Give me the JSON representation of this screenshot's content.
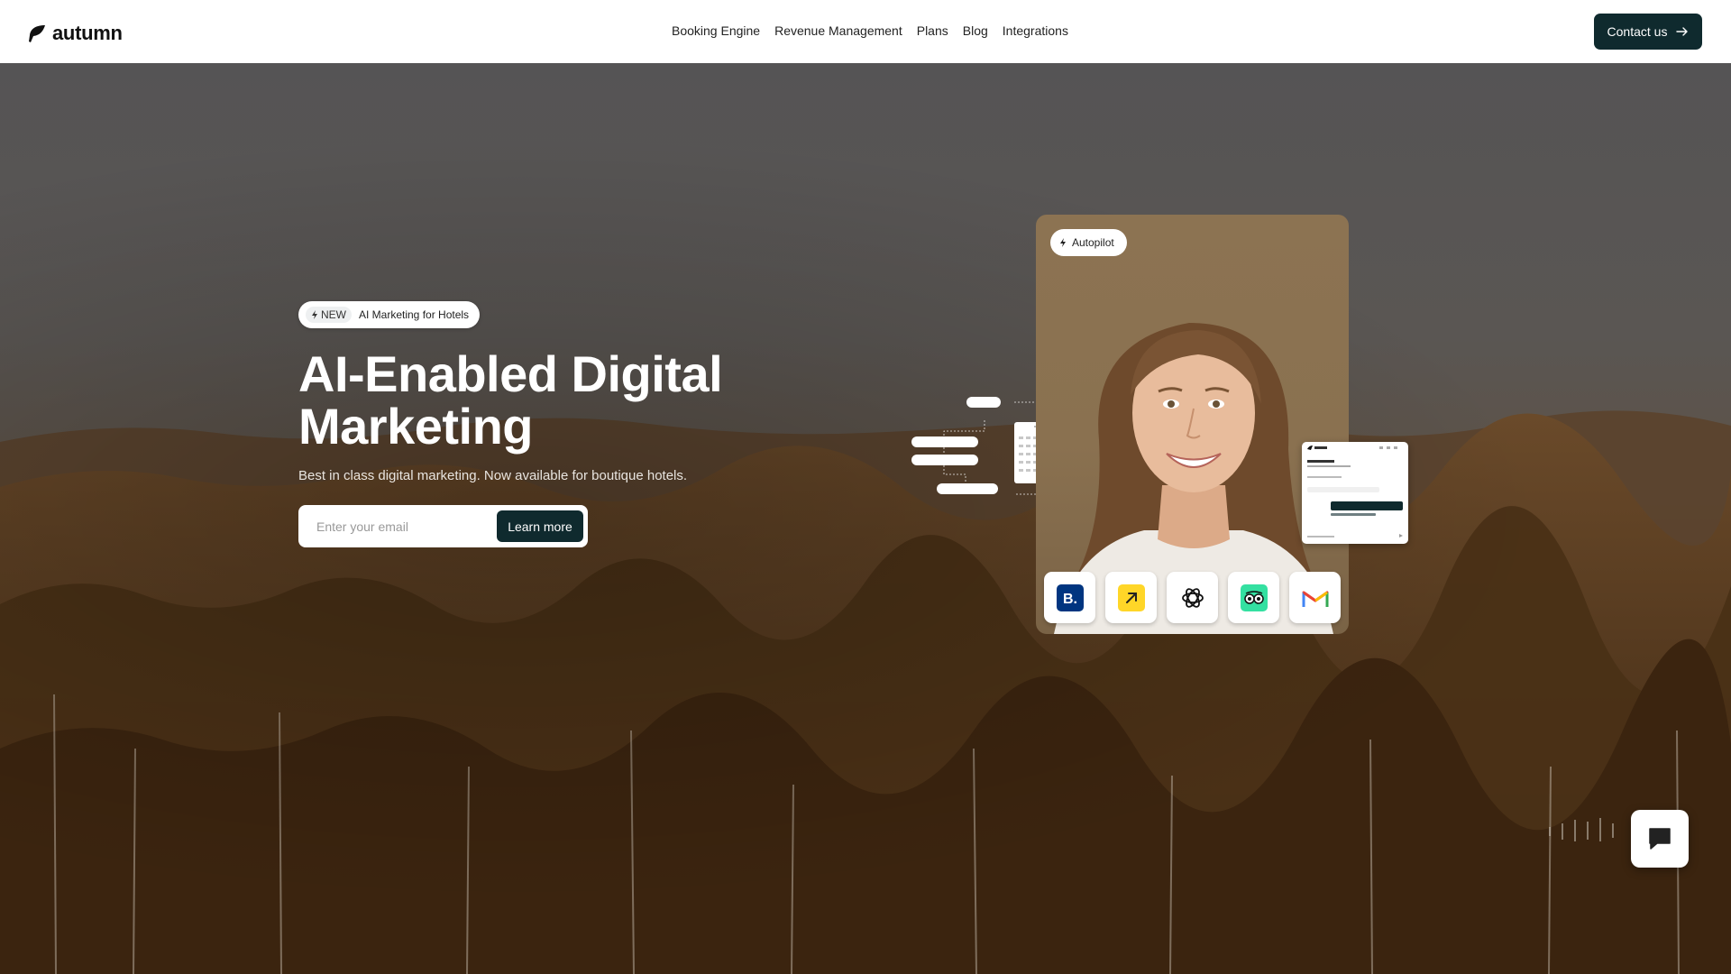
{
  "brand": {
    "name": "autumn"
  },
  "nav": {
    "items": [
      {
        "label": "Booking Engine"
      },
      {
        "label": "Revenue Management"
      },
      {
        "label": "Plans"
      },
      {
        "label": "Blog"
      },
      {
        "label": "Integrations"
      }
    ]
  },
  "header": {
    "contact_label": "Contact us"
  },
  "hero": {
    "badge_new": "NEW",
    "badge_text": "AI Marketing for Hotels",
    "headline": "AI-Enabled Digital Marketing",
    "subline": "Best in class digital marketing. Now available for boutique hotels.",
    "email_placeholder": "Enter your email",
    "cta_label": "Learn more"
  },
  "showcase": {
    "autopilot_label": "Autopilot",
    "integration_icons": [
      "booking-com-icon",
      "arrow-app-icon",
      "openai-icon",
      "tripadvisor-icon",
      "gmail-icon"
    ]
  },
  "colors": {
    "primary": "#0f2a2e",
    "header_bg": "#ffffff",
    "booking_blue": "#003580",
    "arrow_yellow": "#ffd628",
    "tripadvisor_green": "#34e0a1"
  }
}
